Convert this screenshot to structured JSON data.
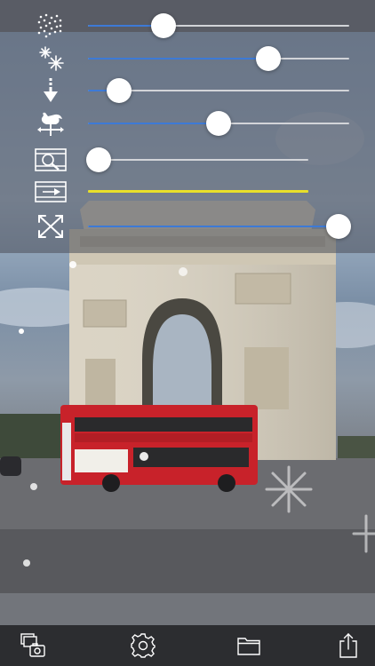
{
  "sliders": [
    {
      "name": "snow-density",
      "icon": "snow-density-icon",
      "value": 0.29
    },
    {
      "name": "flake-size",
      "icon": "snowflakes-icon",
      "value": 0.69
    },
    {
      "name": "fall-speed",
      "icon": "arrow-down-icon",
      "value": 0.12
    },
    {
      "name": "wind",
      "icon": "weathervane-icon",
      "value": 0.5
    },
    {
      "name": "zoom",
      "icon": "zoom-film-icon",
      "value": 0.05
    },
    {
      "name": "playback",
      "icon": "film-arrow-icon",
      "value": 1.0
    },
    {
      "name": "spread",
      "icon": "expand-arrows-icon",
      "value": 0.96
    }
  ],
  "colors": {
    "fill_blue": "#3d7ad6",
    "playback_yellow": "#e7df2a",
    "toolbar_bg": "#2c2d30"
  },
  "toolbar": {
    "buttons": [
      "gallery-camera-icon",
      "settings-gear-icon",
      "folder-icon",
      "share-icon"
    ]
  }
}
